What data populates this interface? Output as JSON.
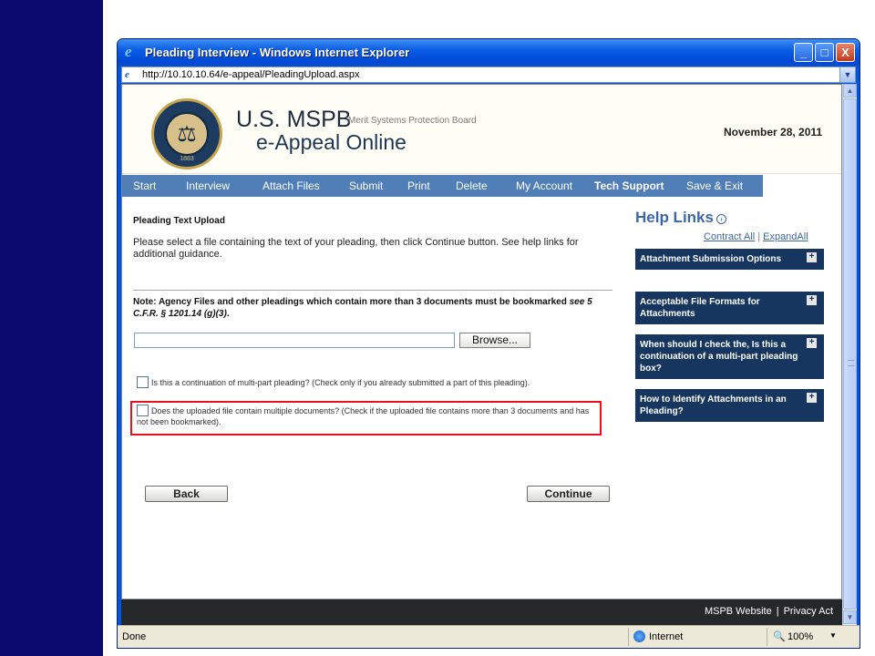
{
  "window": {
    "title": "Pleading Interview - Windows Internet Explorer",
    "url": "http://10.10.10.64/e-appeal/PleadingUpload.aspx",
    "minimize_glyph": "_",
    "maximize_glyph": "□",
    "close_glyph": "X"
  },
  "header": {
    "brand": "U.S. MSPB",
    "subtitle": "Merit Systems Protection Board",
    "app_name": "e-Appeal Online",
    "date": "November 28, 2011",
    "seal_year": "1883"
  },
  "nav": {
    "items": [
      {
        "label": "Start"
      },
      {
        "label": "Interview"
      },
      {
        "label": "Attach Files"
      },
      {
        "label": "Submit"
      },
      {
        "label": "Print"
      },
      {
        "label": "Delete"
      },
      {
        "label": "My Account"
      },
      {
        "label": "Tech Support"
      },
      {
        "label": "Save & Exit"
      }
    ]
  },
  "main": {
    "section_title": "Pleading Text Upload",
    "instructions": "Please select a file containing the text of your pleading, then click Continue button. See help links for additional guidance.",
    "note_prefix": "Note: Agency Files and other pleadings which contain more than 3 documents must be bookmarked ",
    "note_citation": "see 5 C.F.R. § 1201.14 (g)(3)",
    "note_suffix": ".",
    "file_value": "",
    "browse_label": "Browse...",
    "checkbox_continuation": "Is this a continuation of multi-part pleading? (Check only if you already submitted a part of this pleading).",
    "checkbox_multiple": "Does the uploaded file contain multiple documents? (Check if the uploaded file contains more than 3 documents and has not been bookmarked).",
    "back_label": "Back",
    "continue_label": "Continue"
  },
  "help": {
    "title": "Help Links",
    "contract_all": "Contract All",
    "separator": "|",
    "expand_all": "ExpandAll",
    "items": [
      {
        "label": "Attachment Submission Options"
      },
      {
        "label": "Acceptable File Formats for Attachments"
      },
      {
        "label": "When should I check the, Is this a continuation of a multi-part pleading box?"
      },
      {
        "label": "How to Identify Attachments in an Pleading?"
      }
    ]
  },
  "footer": {
    "website": "MSPB Website",
    "separator": "|",
    "privacy": "Privacy Act"
  },
  "statusbar": {
    "status": "Done",
    "zone": "Internet",
    "zoom": "100%"
  },
  "colors": {
    "nav_background": "#4f7fb6",
    "help_card_background": "#16365f",
    "highlight_border": "#e8101a",
    "left_band": "#0a0a6e"
  }
}
